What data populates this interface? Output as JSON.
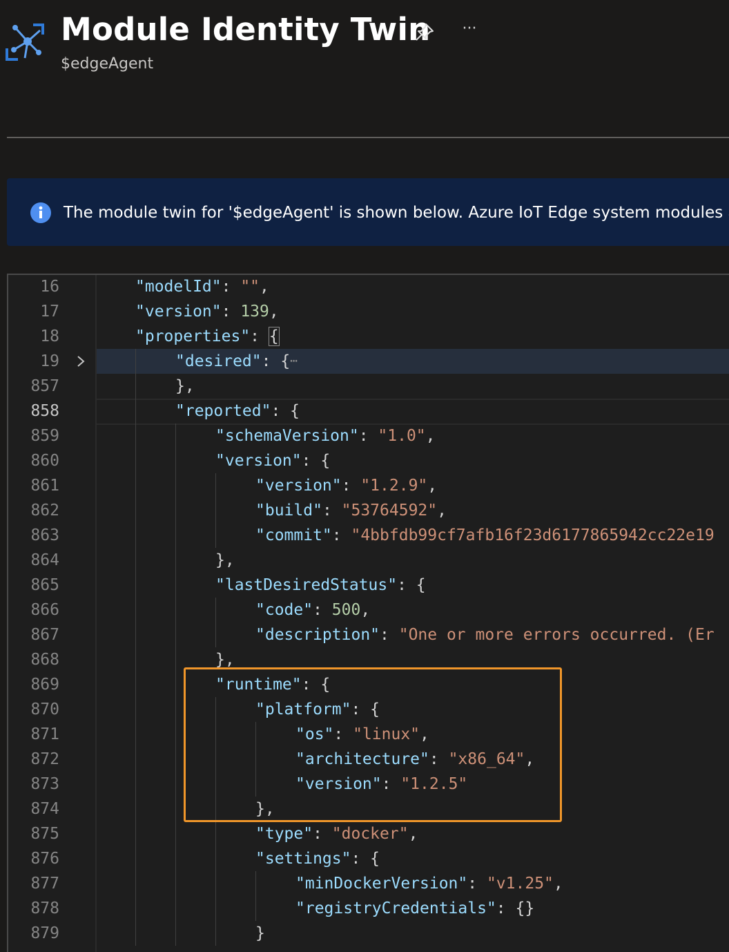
{
  "header": {
    "title": "Module Identity Twin",
    "subtitle": "$edgeAgent",
    "more_label": "···"
  },
  "banner": {
    "text": "The module twin for '$edgeAgent' is shown below. Azure IoT Edge system modules are read-only."
  },
  "editor": {
    "lines": [
      {
        "num": "16",
        "tokens": [
          [
            "k",
            "\"modelId\""
          ],
          [
            "p",
            ": "
          ],
          [
            "s",
            "\"\""
          ],
          [
            "p",
            ","
          ]
        ]
      },
      {
        "num": "17",
        "tokens": [
          [
            "k",
            "\"version\""
          ],
          [
            "p",
            ": "
          ],
          [
            "n",
            "139"
          ],
          [
            "p",
            ","
          ]
        ]
      },
      {
        "num": "18",
        "tokens": [
          [
            "k",
            "\"properties\""
          ],
          [
            "p",
            ": "
          ],
          [
            "p",
            "{"
          ]
        ]
      },
      {
        "num": "19",
        "tokens": [
          [
            "k",
            "\"desired\""
          ],
          [
            "p",
            ": {"
          ]
        ]
      },
      {
        "num": "857",
        "tokens": [
          [
            "p",
            "},"
          ]
        ]
      },
      {
        "num": "858",
        "tokens": [
          [
            "k",
            "\"reported\""
          ],
          [
            "p",
            ": {"
          ]
        ]
      },
      {
        "num": "859",
        "tokens": [
          [
            "k",
            "\"schemaVersion\""
          ],
          [
            "p",
            ": "
          ],
          [
            "s",
            "\"1.0\""
          ],
          [
            "p",
            ","
          ]
        ]
      },
      {
        "num": "860",
        "tokens": [
          [
            "k",
            "\"version\""
          ],
          [
            "p",
            ": {"
          ]
        ]
      },
      {
        "num": "861",
        "tokens": [
          [
            "k",
            "\"version\""
          ],
          [
            "p",
            ": "
          ],
          [
            "s",
            "\"1.2.9\""
          ],
          [
            "p",
            ","
          ]
        ]
      },
      {
        "num": "862",
        "tokens": [
          [
            "k",
            "\"build\""
          ],
          [
            "p",
            ": "
          ],
          [
            "s",
            "\"53764592\""
          ],
          [
            "p",
            ","
          ]
        ]
      },
      {
        "num": "863",
        "tokens": [
          [
            "k",
            "\"commit\""
          ],
          [
            "p",
            ": "
          ],
          [
            "s",
            "\"4bbfdb99cf7afb16f23d6177865942cc22e19"
          ]
        ]
      },
      {
        "num": "864",
        "tokens": [
          [
            "p",
            "},"
          ]
        ]
      },
      {
        "num": "865",
        "tokens": [
          [
            "k",
            "\"lastDesiredStatus\""
          ],
          [
            "p",
            ": {"
          ]
        ]
      },
      {
        "num": "866",
        "tokens": [
          [
            "k",
            "\"code\""
          ],
          [
            "p",
            ": "
          ],
          [
            "n",
            "500"
          ],
          [
            "p",
            ","
          ]
        ]
      },
      {
        "num": "867",
        "tokens": [
          [
            "k",
            "\"description\""
          ],
          [
            "p",
            ": "
          ],
          [
            "s",
            "\"One or more errors occurred. (Er"
          ]
        ]
      },
      {
        "num": "868",
        "tokens": [
          [
            "p",
            "},"
          ]
        ]
      },
      {
        "num": "869",
        "tokens": [
          [
            "k",
            "\"runtime\""
          ],
          [
            "p",
            ": {"
          ]
        ]
      },
      {
        "num": "870",
        "tokens": [
          [
            "k",
            "\"platform\""
          ],
          [
            "p",
            ": {"
          ]
        ]
      },
      {
        "num": "871",
        "tokens": [
          [
            "k",
            "\"os\""
          ],
          [
            "p",
            ": "
          ],
          [
            "s",
            "\"linux\""
          ],
          [
            "p",
            ","
          ]
        ]
      },
      {
        "num": "872",
        "tokens": [
          [
            "k",
            "\"architecture\""
          ],
          [
            "p",
            ": "
          ],
          [
            "s",
            "\"x86_64\""
          ],
          [
            "p",
            ","
          ]
        ]
      },
      {
        "num": "873",
        "tokens": [
          [
            "k",
            "\"version\""
          ],
          [
            "p",
            ": "
          ],
          [
            "s",
            "\"1.2.5\""
          ]
        ]
      },
      {
        "num": "874",
        "tokens": [
          [
            "p",
            "},"
          ]
        ]
      },
      {
        "num": "875",
        "tokens": [
          [
            "k",
            "\"type\""
          ],
          [
            "p",
            ": "
          ],
          [
            "s",
            "\"docker\""
          ],
          [
            "p",
            ","
          ]
        ]
      },
      {
        "num": "876",
        "tokens": [
          [
            "k",
            "\"settings\""
          ],
          [
            "p",
            ": {"
          ]
        ]
      },
      {
        "num": "877",
        "tokens": [
          [
            "k",
            "\"minDockerVersion\""
          ],
          [
            "p",
            ": "
          ],
          [
            "s",
            "\"v1.25\""
          ],
          [
            "p",
            ","
          ]
        ]
      },
      {
        "num": "878",
        "tokens": [
          [
            "k",
            "\"registryCredentials\""
          ],
          [
            "p",
            ": {}"
          ]
        ]
      },
      {
        "num": "879",
        "tokens": [
          [
            "p",
            "}"
          ]
        ]
      }
    ]
  }
}
